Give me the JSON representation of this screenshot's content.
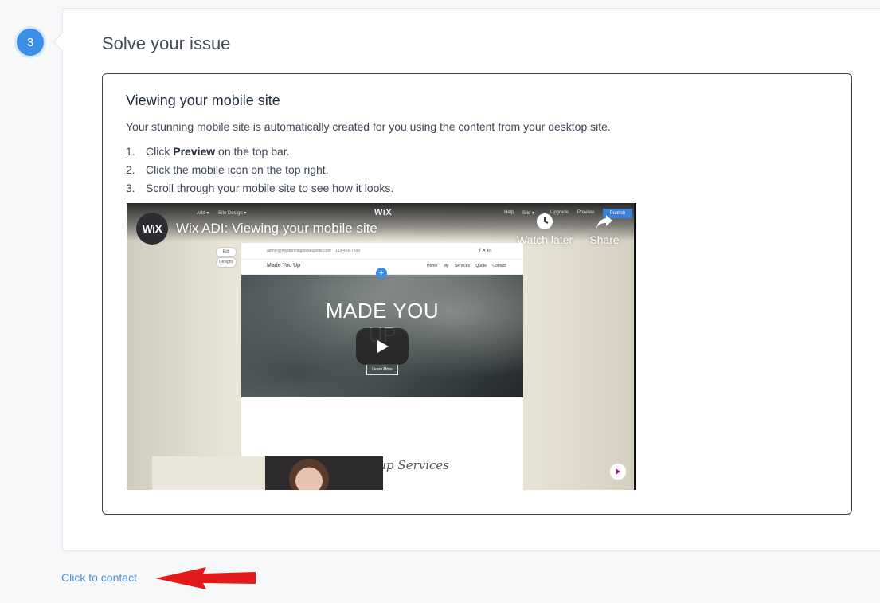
{
  "step": {
    "number": "3"
  },
  "card": {
    "title": "Solve your issue"
  },
  "article": {
    "title": "Viewing your mobile site",
    "intro": "Your stunning mobile site is automatically created for you using the content from your desktop site.",
    "steps": [
      {
        "num": "1.",
        "pre": "Click ",
        "bold": "Preview",
        "post": " on the top bar."
      },
      {
        "num": "2.",
        "pre": "Click the mobile icon on the top right.",
        "bold": "",
        "post": ""
      },
      {
        "num": "3.",
        "pre": "Scroll through your mobile site to see how it looks.",
        "bold": "",
        "post": ""
      }
    ]
  },
  "video": {
    "channel_logo": "WiX",
    "title": "Wix ADI: Viewing your mobile site",
    "watch_later": "Watch later",
    "share": "Share",
    "editor": {
      "menu_add": "Add ▾",
      "menu_site_design": "Site Design ▾",
      "logo_text": "WiX",
      "help": "Help",
      "site": "Site ▾",
      "upgrade": "Upgrade",
      "preview": "Preview",
      "publish": "Publish",
      "edit": "Edit",
      "designs": "Designs"
    },
    "site": {
      "email": "admin@mystunningmakeupsite.com",
      "phone": "123-456-7890",
      "name": "Made You Up",
      "nav": [
        "Home",
        "My Services",
        "Quote",
        "Contact"
      ],
      "hero_line1": "MADE YOU",
      "hero_line2": "UP",
      "learn_more": "Learn More",
      "services_heading": "Professional Makeup Services"
    }
  },
  "footer": {
    "contact_link": "Click to contact"
  },
  "colors": {
    "accent": "#3b8fe6",
    "link": "#4d8fd6",
    "arrow": "#e3191c"
  }
}
